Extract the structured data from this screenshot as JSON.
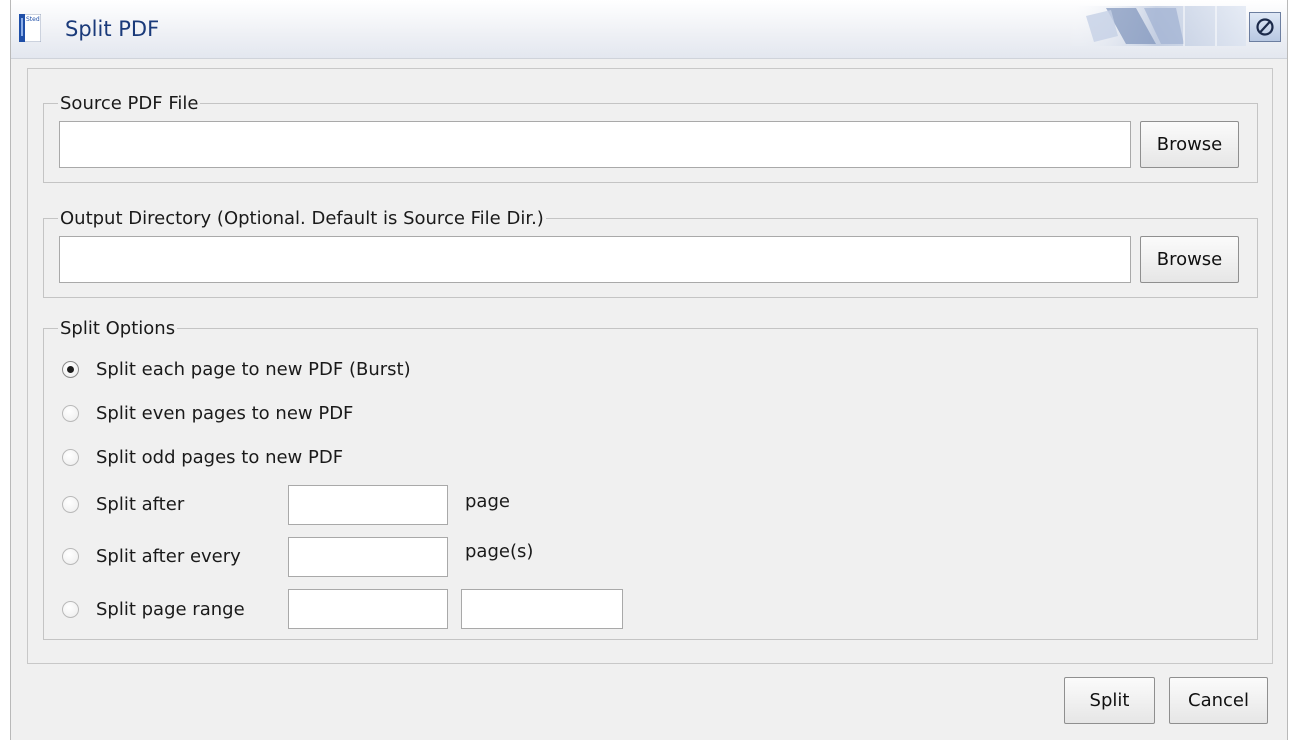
{
  "window": {
    "title": "Split PDF",
    "icon_text": "Sted",
    "close_icon": "no-entry-symbol"
  },
  "source": {
    "legend": "Source PDF File",
    "value": "",
    "browse_label": "Browse"
  },
  "output": {
    "legend": "Output Directory (Optional. Default is Source File Dir.)",
    "value": "",
    "browse_label": "Browse"
  },
  "options": {
    "legend": "Split Options",
    "selected": "burst",
    "items": [
      {
        "id": "burst",
        "label": "Split each page to new PDF (Burst)"
      },
      {
        "id": "even",
        "label": "Split even pages to new PDF"
      },
      {
        "id": "odd",
        "label": "Split odd pages to new PDF"
      },
      {
        "id": "after",
        "label": "Split after",
        "suffix": "page"
      },
      {
        "id": "every",
        "label": "Split after every",
        "suffix": "page(s)"
      },
      {
        "id": "range",
        "label": "Split page range"
      }
    ],
    "after_value": "",
    "every_value": "",
    "range_from": "",
    "range_to": ""
  },
  "footer": {
    "split_label": "Split",
    "cancel_label": "Cancel"
  },
  "colors": {
    "title_text": "#1a3a7a",
    "dialog_bg": "#f0f0f0",
    "border": "#c4c4c4"
  }
}
